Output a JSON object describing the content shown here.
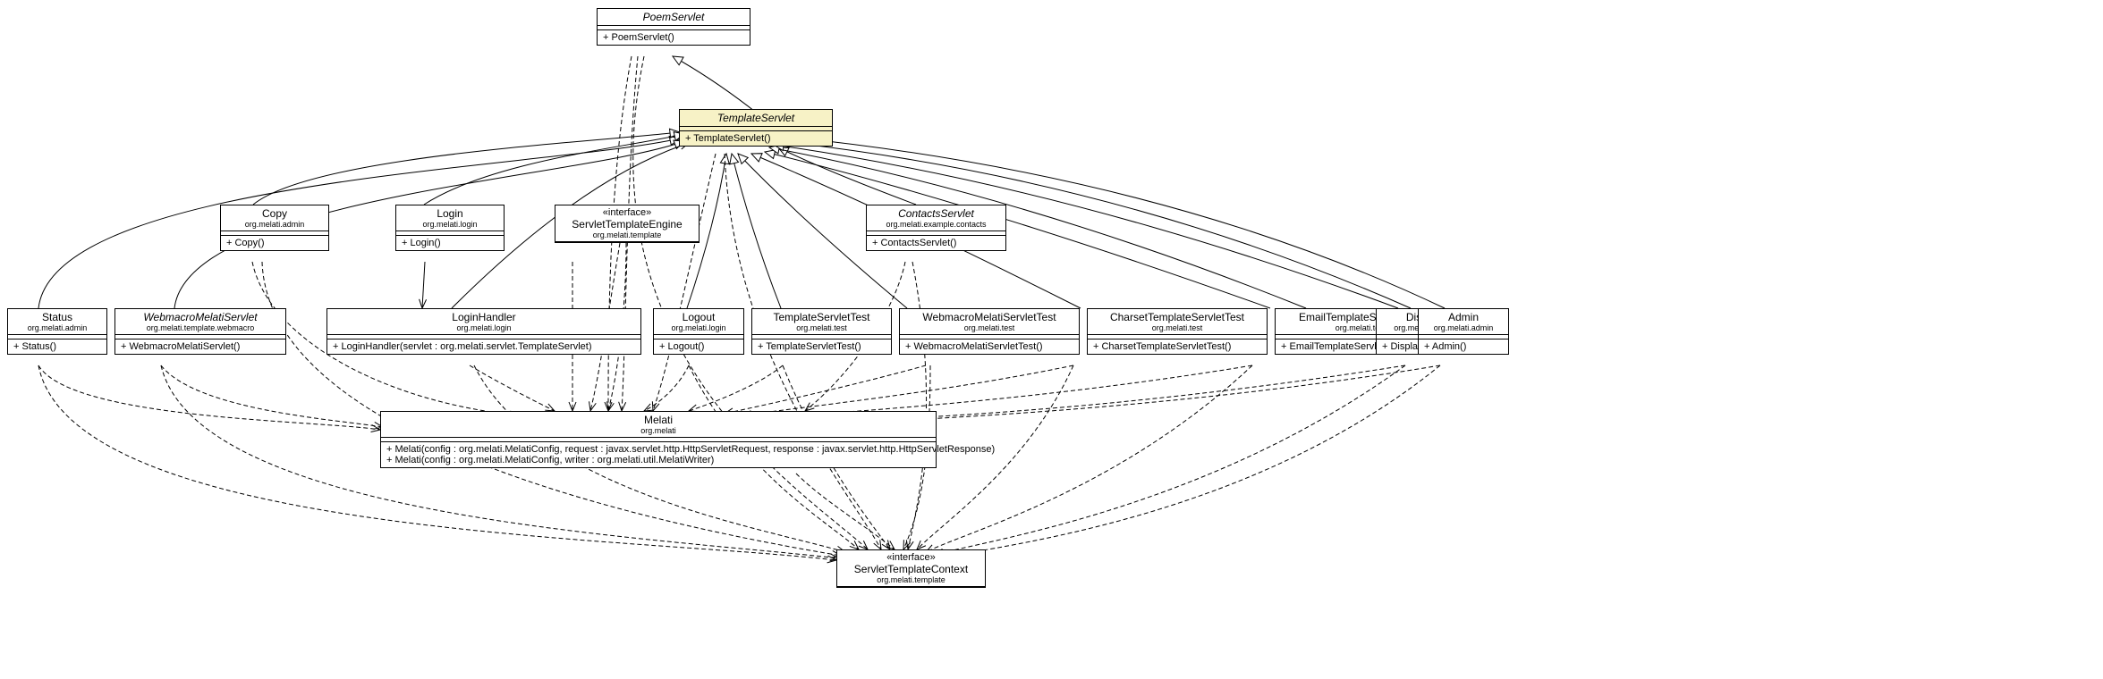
{
  "classes": {
    "poemServlet": {
      "name": "PoemServlet",
      "italic": true,
      "method": "+ PoemServlet()"
    },
    "templateServlet": {
      "name": "TemplateServlet",
      "italic": true,
      "method": "+ TemplateServlet()"
    },
    "copy": {
      "name": "Copy",
      "pkg": "org.melati.admin",
      "method": "+ Copy()"
    },
    "login": {
      "name": "Login",
      "pkg": "org.melati.login",
      "method": "+ Login()"
    },
    "servletTemplateEngine": {
      "stereotype": "«interface»",
      "name": "ServletTemplateEngine",
      "pkg": "org.melati.template"
    },
    "contactsServlet": {
      "name": "ContactsServlet",
      "italic": true,
      "pkg": "org.melati.example.contacts",
      "method": "+ ContactsServlet()"
    },
    "status": {
      "name": "Status",
      "pkg": "org.melati.admin",
      "method": "+ Status()"
    },
    "webmacroMelatiServlet": {
      "name": "WebmacroMelatiServlet",
      "italic": true,
      "pkg": "org.melati.template.webmacro",
      "method": "+ WebmacroMelatiServlet()"
    },
    "loginHandler": {
      "name": "LoginHandler",
      "pkg": "org.melati.login",
      "method": "+ LoginHandler(servlet : org.melati.servlet.TemplateServlet)"
    },
    "logout": {
      "name": "Logout",
      "pkg": "org.melati.login",
      "method": "+ Logout()"
    },
    "templateServletTest": {
      "name": "TemplateServletTest",
      "pkg": "org.melati.test",
      "method": "+ TemplateServletTest()"
    },
    "webmacroMelatiServletTest": {
      "name": "WebmacroMelatiServletTest",
      "pkg": "org.melati.test",
      "method": "+ WebmacroMelatiServletTest()"
    },
    "charsetTemplateServletTest": {
      "name": "CharsetTemplateServletTest",
      "pkg": "org.melati.test",
      "method": "+ CharsetTemplateServletTest()"
    },
    "emailTemplateServletTest": {
      "name": "EmailTemplateServletTest",
      "pkg": "org.melati.test",
      "method": "+ EmailTemplateServletTest()"
    },
    "display": {
      "name": "Display",
      "pkg": "org.melati.admin",
      "method": "+ Display()"
    },
    "admin": {
      "name": "Admin",
      "pkg": "org.melati.admin",
      "method": "+ Admin()"
    },
    "melati": {
      "name": "Melati",
      "pkg": "org.melati",
      "method1": "+ Melati(config : org.melati.MelatiConfig, request : javax.servlet.http.HttpServletRequest, response : javax.servlet.http.HttpServletResponse)",
      "method2": "+ Melati(config : org.melati.MelatiConfig, writer : org.melati.util.MelatiWriter)"
    },
    "servletTemplateContext": {
      "stereotype": "«interface»",
      "name": "ServletTemplateContext",
      "pkg": "org.melati.template"
    }
  }
}
